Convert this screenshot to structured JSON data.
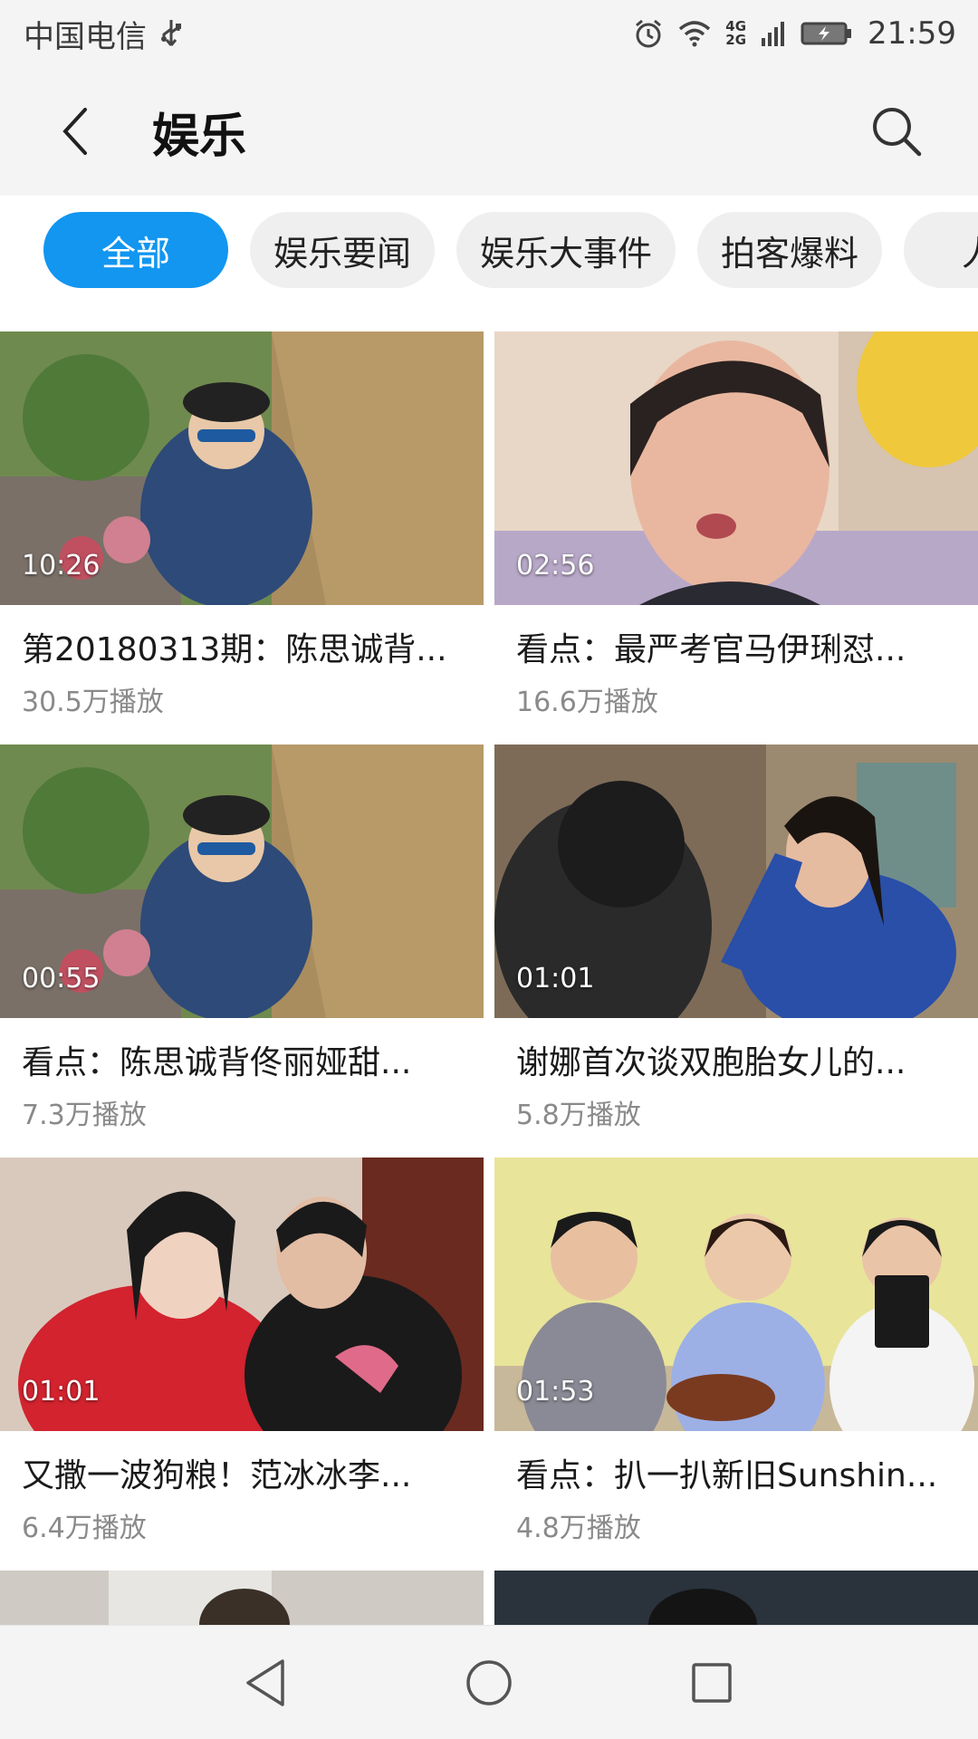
{
  "status_bar": {
    "carrier": "中国电信",
    "network": "4G\n2G",
    "time": "21:59",
    "icons": [
      "usb-icon",
      "alarm-icon",
      "wifi-icon",
      "signal-icon",
      "battery-charging-icon"
    ]
  },
  "header": {
    "title": "娱乐",
    "back_icon": "back-arrow-icon",
    "search_icon": "search-icon"
  },
  "tabs": [
    {
      "label": "全部",
      "active": true
    },
    {
      "label": "娱乐要闻",
      "active": false
    },
    {
      "label": "娱乐大事件",
      "active": false
    },
    {
      "label": "拍客爆料",
      "active": false
    },
    {
      "label": "人人",
      "active": false
    }
  ],
  "videos": [
    {
      "duration": "10:26",
      "title": "第20180313期：陈思诚背...",
      "views": "30.5万播放"
    },
    {
      "duration": "02:56",
      "title": "看点：最严考官马伊琍怼...",
      "views": "16.6万播放"
    },
    {
      "duration": "00:55",
      "title": "看点：陈思诚背佟丽娅甜...",
      "views": "7.3万播放"
    },
    {
      "duration": "01:01",
      "title": "谢娜首次谈双胞胎女儿的...",
      "views": "5.8万播放"
    },
    {
      "duration": "01:01",
      "title": "又撒一波狗粮！范冰冰李...",
      "views": "6.4万播放"
    },
    {
      "duration": "01:53",
      "title": "看点：扒一扒新旧Sunshin...",
      "views": "4.8万播放"
    }
  ],
  "nav": {
    "back": "nav-back-icon",
    "home": "nav-home-icon",
    "recents": "nav-recents-icon"
  },
  "colors": {
    "accent": "#1296f0",
    "bar_bg": "#f4f4f4",
    "tab_bg": "#efefef",
    "secondary_text": "#8a8a8a"
  }
}
